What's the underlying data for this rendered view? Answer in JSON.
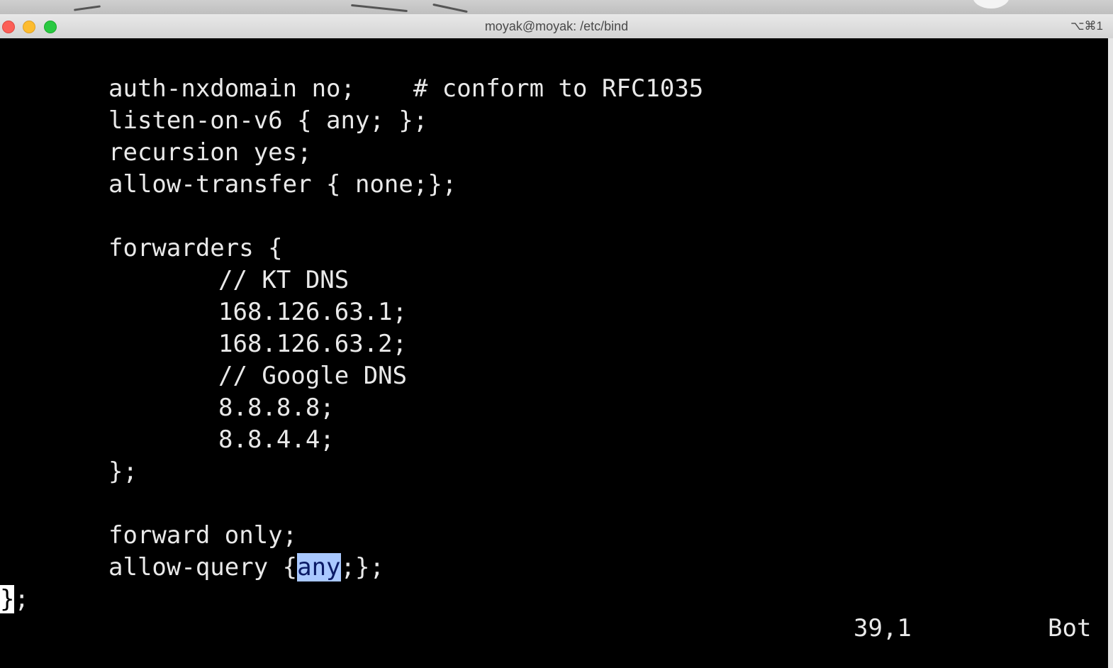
{
  "window": {
    "title": "moyak@moyak: /etc/bind",
    "shortcut": "⌥⌘1"
  },
  "editor": {
    "lines": [
      "auth-nxdomain no;    # conform to RFC1035",
      "listen-on-v6 { any; };",
      "recursion yes;",
      "allow-transfer { none;};",
      "",
      "forwarders {",
      "// KT DNS",
      "168.126.63.1;",
      "168.126.63.2;",
      "// Google DNS",
      "8.8.8.8;",
      "8.8.4.4;",
      "};",
      "",
      "forward only;",
      "allow-query {",
      "any",
      ";};",
      "}",
      ";"
    ]
  },
  "statusline": {
    "position": "39,1",
    "scroll": "Bot"
  },
  "colors": {
    "background": "#000000",
    "text": "#e9e9e9",
    "selection": "#a9c8ff"
  }
}
